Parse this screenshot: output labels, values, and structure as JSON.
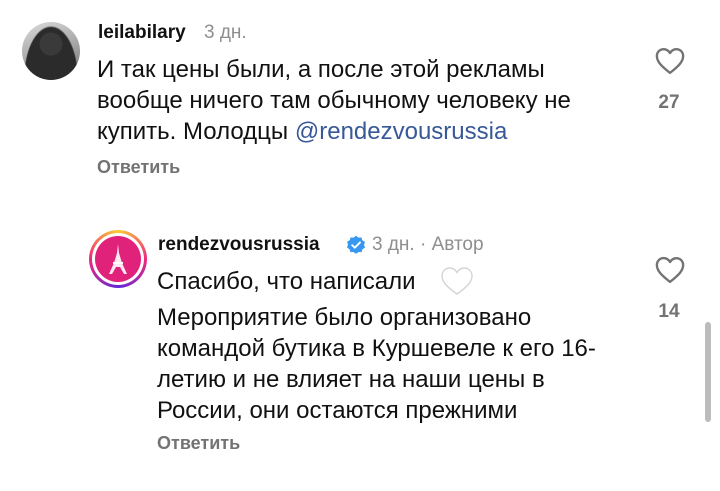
{
  "comments": [
    {
      "username": "leilabilary",
      "time": "3 дн.",
      "text": "И так цены были, а после этой рекламы вообще ничего там обычному человеку не купить. Молодцы ",
      "mention": "@rendezvousrussia",
      "reply_label": "Ответить",
      "likes": "27"
    },
    {
      "username": "rendezvousrussia",
      "meta": "3 дн. · Автор",
      "line1": "Спасибо, что написали",
      "body": "Мероприятие было организовано командой бутика в Куршевеле к его 16-летию и не влияет на наши цены в России, они остаются прежними",
      "reply_label": "Ответить",
      "likes": "14"
    }
  ],
  "icons": {
    "like": "heart-outline-icon",
    "verified": "verified-badge-icon",
    "emoji": "white-heart-emoji"
  },
  "colors": {
    "mention": "#385898",
    "verified": "#3897f0",
    "muted": "#737373"
  }
}
